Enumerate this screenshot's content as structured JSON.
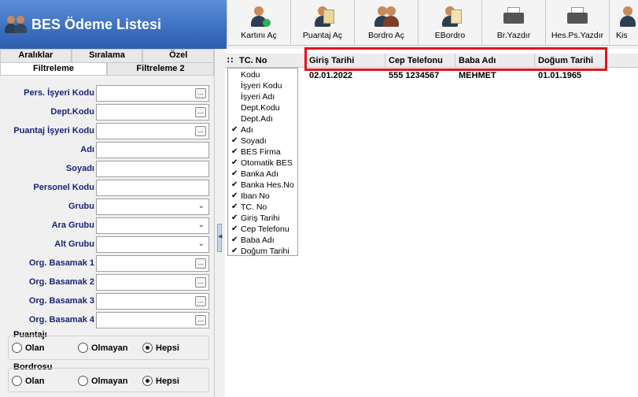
{
  "window": {
    "title": "BES Ödeme Listesi"
  },
  "toolbar": {
    "buttons": [
      {
        "label": "Kartını Aç",
        "icon": "person-check-icon"
      },
      {
        "label": "Puantaj Aç",
        "icon": "person-doc-icon"
      },
      {
        "label": "Bordro Aç",
        "icon": "people-icon"
      },
      {
        "label": "EBordro",
        "icon": "person-doc-icon"
      },
      {
        "label": "Br.Yazdır",
        "icon": "printer-icon"
      },
      {
        "label": "Hes.Ps.Yazdır",
        "icon": "printer-icon"
      },
      {
        "label": "Kis",
        "icon": "person-icon"
      }
    ]
  },
  "left": {
    "tabs_row1": [
      "Aralıklar",
      "Sıralama",
      "Özel"
    ],
    "tabs_row2": [
      "Filtreleme",
      "Filtreleme 2"
    ],
    "fields": [
      {
        "label": "Pers. İşyeri Kodu",
        "kind": "lookup"
      },
      {
        "label": "Dept.Kodu",
        "kind": "lookup"
      },
      {
        "label": "Puantaj İşyeri Kodu",
        "kind": "lookup"
      },
      {
        "label": "Adı",
        "kind": "text"
      },
      {
        "label": "Soyadı",
        "kind": "text"
      },
      {
        "label": "Personel Kodu",
        "kind": "text"
      },
      {
        "label": "Grubu",
        "kind": "select"
      },
      {
        "label": "Ara Grubu",
        "kind": "select"
      },
      {
        "label": "Alt Grubu",
        "kind": "select"
      },
      {
        "label": "Org. Basamak 1",
        "kind": "lookup"
      },
      {
        "label": "Org. Basamak 2",
        "kind": "lookup"
      },
      {
        "label": "Org. Basamak 3",
        "kind": "lookup"
      },
      {
        "label": "Org. Basamak 4",
        "kind": "lookup"
      }
    ],
    "puantaji": {
      "label": "Puantajı",
      "options": [
        "Olan",
        "Olmayan",
        "Hepsi"
      ],
      "selected": "Hepsi"
    },
    "bordrosu": {
      "label": "Bordrosu",
      "options": [
        "Olan",
        "Olmayan",
        "Hepsi"
      ],
      "selected": "Hepsi"
    }
  },
  "grid": {
    "columns": [
      "TC. No",
      "Giriş Tarihi",
      "Cep Telefonu",
      "Baba Adı",
      "Doğum Tarihi"
    ],
    "row": [
      "",
      "02.01.2022",
      "555 1234567",
      "MEHMET",
      "01.01.1965"
    ],
    "column_menu": [
      {
        "label": "Kodu",
        "checked": false
      },
      {
        "label": "İşyeri Kodu",
        "checked": false
      },
      {
        "label": "İşyeri Adı",
        "checked": false
      },
      {
        "label": "Dept.Kodu",
        "checked": false
      },
      {
        "label": "Dept.Adı",
        "checked": false
      },
      {
        "label": "Adı",
        "checked": true
      },
      {
        "label": "Soyadı",
        "checked": true
      },
      {
        "label": "BES Firma",
        "checked": true
      },
      {
        "label": "Otomatik BES",
        "checked": true
      },
      {
        "label": "Banka Adı",
        "checked": true
      },
      {
        "label": "Banka Hes.No",
        "checked": true
      },
      {
        "label": "Iban No",
        "checked": true
      },
      {
        "label": "TC. No",
        "checked": true
      },
      {
        "label": "Giriş Tarihi",
        "checked": true
      },
      {
        "label": "Cep Telefonu",
        "checked": true
      },
      {
        "label": "Baba Adı",
        "checked": true
      },
      {
        "label": "Doğum Tarihi",
        "checked": true
      }
    ],
    "check_mark": "✔"
  },
  "colors": {
    "title_bg": "#3b6fc0",
    "label_blue": "#1a237e",
    "highlight": "#e0141e"
  }
}
